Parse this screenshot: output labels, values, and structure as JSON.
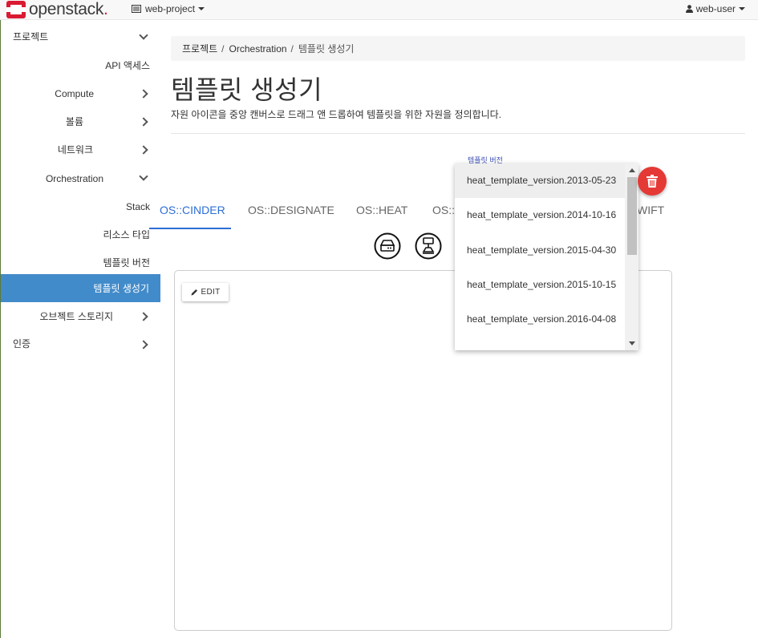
{
  "navbar": {
    "brand": "openstack",
    "brand_dot": ".",
    "project": "web-project",
    "user": "web-user"
  },
  "sidebar": {
    "items": [
      {
        "label": "프로젝트"
      },
      {
        "label": "API 액세스"
      },
      {
        "label": "Compute"
      },
      {
        "label": "볼륨"
      },
      {
        "label": "네트워크"
      },
      {
        "label": "Orchestration"
      },
      {
        "label": "Stack"
      },
      {
        "label": "리소스 타입"
      },
      {
        "label": "템플릿 버전"
      },
      {
        "label": "템플릿 생성기"
      },
      {
        "label": "오브젝트 스토리지"
      },
      {
        "label": "인증"
      }
    ]
  },
  "breadcrumb": {
    "items": [
      "프로젝트",
      "Orchestration",
      "템플릿 생성기"
    ],
    "separator": "/"
  },
  "page": {
    "title": "템플릿 생성기",
    "description": "자원 아이콘을 중앙 캔버스로 드래그 앤 드롭하여 템플릿을 위한 자원을 정의합니다."
  },
  "tabs": [
    {
      "label": "OS::CINDER",
      "active": true
    },
    {
      "label": "OS::DESIGNATE"
    },
    {
      "label": "OS::HEAT"
    },
    {
      "label": "OS::N"
    },
    {
      "label": "WIFT"
    }
  ],
  "resource_icons": [
    "hard-drive-icon",
    "volume-attachment-icon"
  ],
  "canvas": {
    "edit_label": "EDIT"
  },
  "template_version": {
    "label": "템플릿 버전",
    "options": [
      "heat_template_version.2013-05-23",
      "heat_template_version.2014-10-16",
      "heat_template_version.2015-04-30",
      "heat_template_version.2015-10-15",
      "heat_template_version.2016-04-08"
    ],
    "selected": "heat_template_version.2013-05-23"
  },
  "colors": {
    "accent": "#428bca",
    "tab_active": "#2d6ed6",
    "delete": "#e53935",
    "brand_red": "#da1a32"
  }
}
